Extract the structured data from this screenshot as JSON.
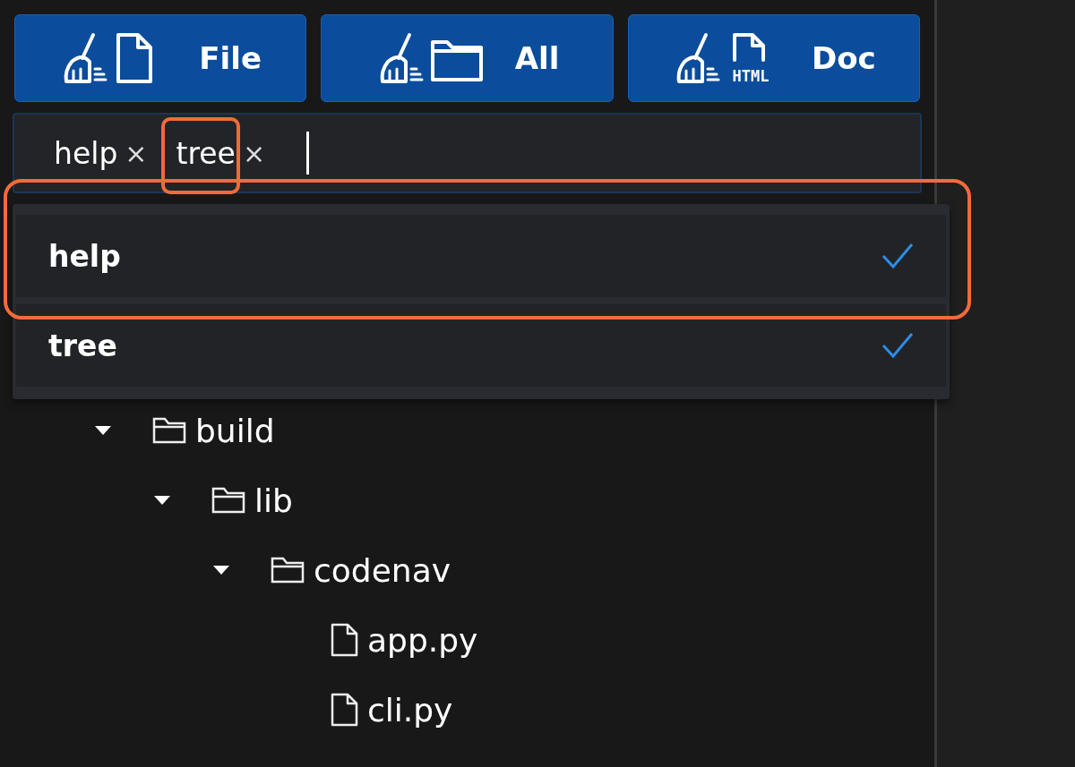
{
  "clean_buttons": [
    {
      "label": "File",
      "kind": "file"
    },
    {
      "label": "All",
      "kind": "folder"
    },
    {
      "label": "Doc",
      "kind": "html",
      "icon_text": "HTML"
    }
  ],
  "tag_input": {
    "tags": [
      {
        "label": "help",
        "remove": "×"
      },
      {
        "label": "tree",
        "remove": "×"
      }
    ]
  },
  "dropdown": {
    "options": [
      {
        "label": "help",
        "selected": true
      },
      {
        "label": "tree",
        "selected": true
      }
    ]
  },
  "tree": [
    {
      "label": "build",
      "kind": "folder",
      "expanded": true,
      "children": [
        {
          "label": "lib",
          "kind": "folder",
          "expanded": true,
          "children": [
            {
              "label": "codenav",
              "kind": "folder",
              "expanded": true,
              "children": [
                {
                  "label": "app.py",
                  "kind": "file"
                },
                {
                  "label": "cli.py",
                  "kind": "file"
                }
              ]
            }
          ]
        }
      ]
    }
  ]
}
